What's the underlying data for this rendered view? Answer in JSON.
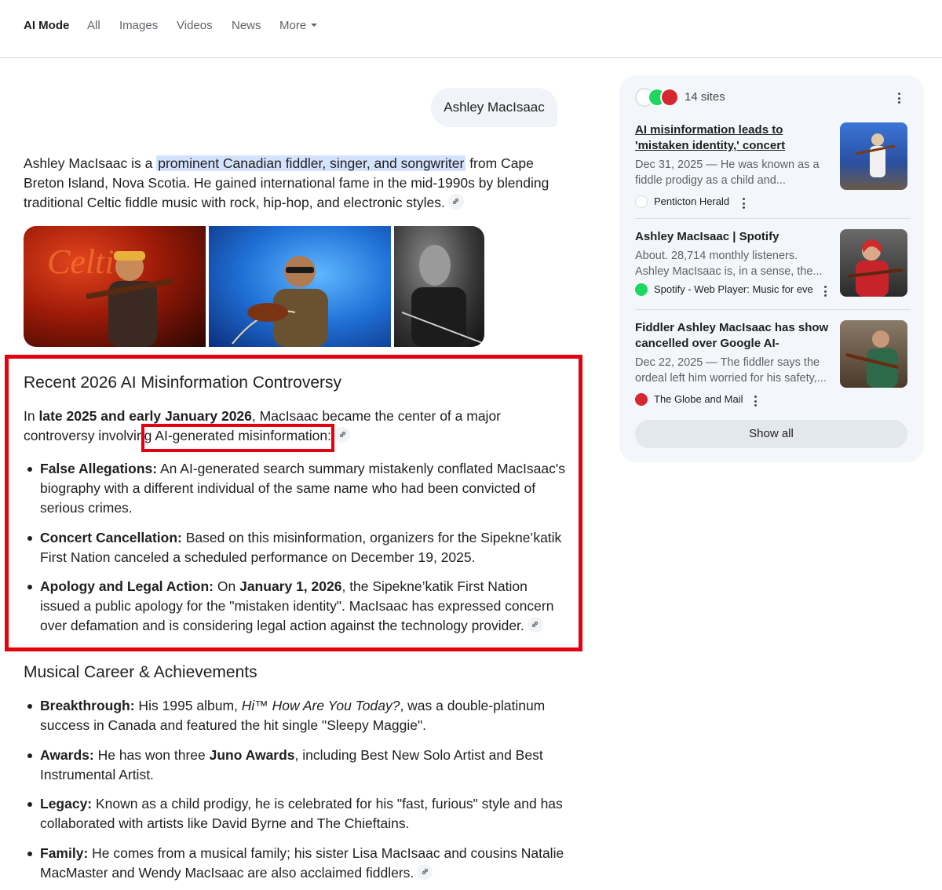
{
  "nav": {
    "tabs": [
      "AI Mode",
      "All",
      "Images",
      "Videos",
      "News",
      "More"
    ]
  },
  "query": "Ashley MacIsaac",
  "intro": {
    "before": "Ashley MacIsaac is a ",
    "highlight": "prominent Canadian fiddler, singer, and songwriter",
    "after": " from Cape Breton Island, Nova Scotia. He gained international fame in the mid-1990s by blending traditional Celtic fiddle music with rock, hip-hop, and electronic styles."
  },
  "section1": {
    "heading": "Recent 2026 AI Misinformation Controversy",
    "lead_1": "In ",
    "lead_bold": "late 2025 and early January 2026",
    "lead_2": ", MacIsaac became the center of a major controversy involving ",
    "lead_3": "AI-generated misinformation:",
    "bullets": [
      {
        "label": "False Allegations:",
        "text": " An AI-generated search summary mistakenly conflated MacIsaac's biography with a different individual of the same name who had been convicted of serious crimes."
      },
      {
        "label": "Concert Cancellation:",
        "text": " Based on this misinformation, organizers for the Sipekne’katik First Nation canceled a scheduled performance on December 19, 2025."
      },
      {
        "label": "Apology and Legal Action:",
        "text_1": " On ",
        "bold_date": "January 1, 2026",
        "text_2": ", the Sipekne’katik First Nation issued a public apology for the \"mistaken identity\". MacIsaac has expressed concern over defamation and is considering legal action against the technology provider."
      }
    ]
  },
  "section2": {
    "heading": "Musical Career & Achievements",
    "bullets": [
      {
        "label": "Breakthrough:",
        "text_1": " His 1995 album, ",
        "italic": "Hi™ How Are You Today?",
        "text_2": ", was a double-platinum success in Canada and featured the hit single \"Sleepy Maggie\"."
      },
      {
        "label": "Awards:",
        "text_1": " He has won three ",
        "bold_mid": "Juno Awards",
        "text_2": ", including Best New Solo Artist and Best Instrumental Artist."
      },
      {
        "label": "Legacy:",
        "text": " Known as a child prodigy, he is celebrated for his \"fast, furious\" style and has collaborated with artists like David Byrne and The Chieftains."
      },
      {
        "label": "Family:",
        "text": " He comes from a musical family; his sister Lisa MacIsaac and cousins Natalie MacMaster and Wendy MacIsaac are also acclaimed fiddlers."
      }
    ]
  },
  "sources": {
    "count_label": "14 sites",
    "cards": [
      {
        "title": "AI misinformation leads to 'mistaken identity,' concert cancellation for...",
        "snippet": "Dec 31, 2025 — He was known as a fiddle prodigy as a child and...",
        "source": "Penticton Herald"
      },
      {
        "title": "Ashley MacIsaac | Spotify",
        "snippet": "About. 28,714 monthly listeners. Ashley MacIsaac is, in a sense, the...",
        "source": "Spotify - Web Player: Music for eve"
      },
      {
        "title": "Fiddler Ashley MacIsaac has show cancelled over Google AI-generate...",
        "snippet": "Dec 22, 2025 — The fiddler says the ordeal left him worried for his safety,...",
        "source": "The Globe and Mail"
      }
    ],
    "show_all": "Show all"
  },
  "colors": {
    "highlight": "#d3e3fd",
    "annotation_red": "#e3000f",
    "panel_bg": "#f3f6fb",
    "spotify_green": "#1ed760",
    "globe_red": "#d6262f"
  }
}
